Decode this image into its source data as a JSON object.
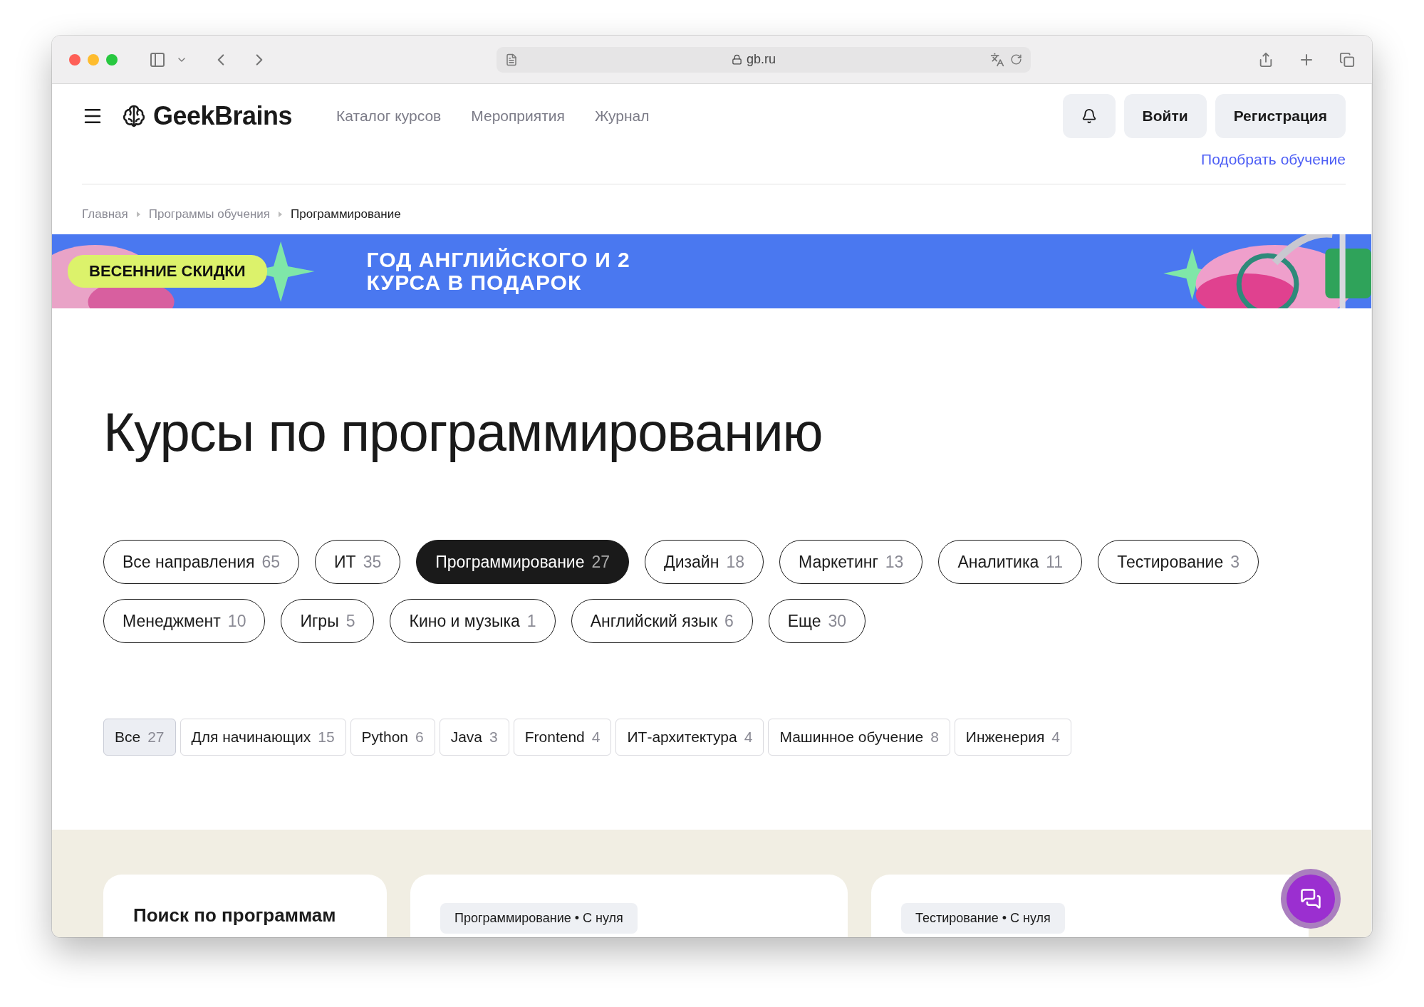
{
  "browser": {
    "url": "gb.ru"
  },
  "header": {
    "logo": "GeekBrains",
    "nav": [
      "Каталог курсов",
      "Мероприятия",
      "Журнал"
    ],
    "login": "Войти",
    "register": "Регистрация",
    "pick_link": "Подобрать обучение"
  },
  "breadcrumbs": [
    {
      "label": "Главная",
      "current": false
    },
    {
      "label": "Программы обучения",
      "current": false
    },
    {
      "label": "Программирование",
      "current": true
    }
  ],
  "banner": {
    "badge": "ВЕСЕННИЕ СКИДКИ",
    "title_lines": [
      "ГОД АНГЛИЙСКОГО И 2",
      "КУРСА В ПОДАРОК"
    ]
  },
  "title": "Курсы по программированию",
  "directions": [
    {
      "label": "Все направления",
      "count": "65",
      "selected": false
    },
    {
      "label": "ИТ",
      "count": "35",
      "selected": false
    },
    {
      "label": "Программирование",
      "count": "27",
      "selected": true
    },
    {
      "label": "Дизайн",
      "count": "18",
      "selected": false
    },
    {
      "label": "Маркетинг",
      "count": "13",
      "selected": false
    },
    {
      "label": "Аналитика",
      "count": "11",
      "selected": false
    },
    {
      "label": "Тестирование",
      "count": "3",
      "selected": false
    },
    {
      "label": "Менеджмент",
      "count": "10",
      "selected": false
    },
    {
      "label": "Игры",
      "count": "5",
      "selected": false
    },
    {
      "label": "Кино и музыка",
      "count": "1",
      "selected": false
    },
    {
      "label": "Английский язык",
      "count": "6",
      "selected": false
    },
    {
      "label": "Еще",
      "count": "30",
      "selected": false
    }
  ],
  "topics": [
    {
      "label": "Все",
      "count": "27",
      "selected": true
    },
    {
      "label": "Для начинающих",
      "count": "15",
      "selected": false
    },
    {
      "label": "Python",
      "count": "6",
      "selected": false
    },
    {
      "label": "Java",
      "count": "3",
      "selected": false
    },
    {
      "label": "Frontend",
      "count": "4",
      "selected": false
    },
    {
      "label": "ИТ-архитектура",
      "count": "4",
      "selected": false
    },
    {
      "label": "Машинное обучение",
      "count": "8",
      "selected": false
    },
    {
      "label": "Инженерия",
      "count": "4",
      "selected": false
    }
  ],
  "search_card": {
    "title": "Поиск по программам"
  },
  "course_cards": [
    {
      "tag": "Программирование • С нуля"
    },
    {
      "tag": "Тестирование • С нуля"
    }
  ]
}
